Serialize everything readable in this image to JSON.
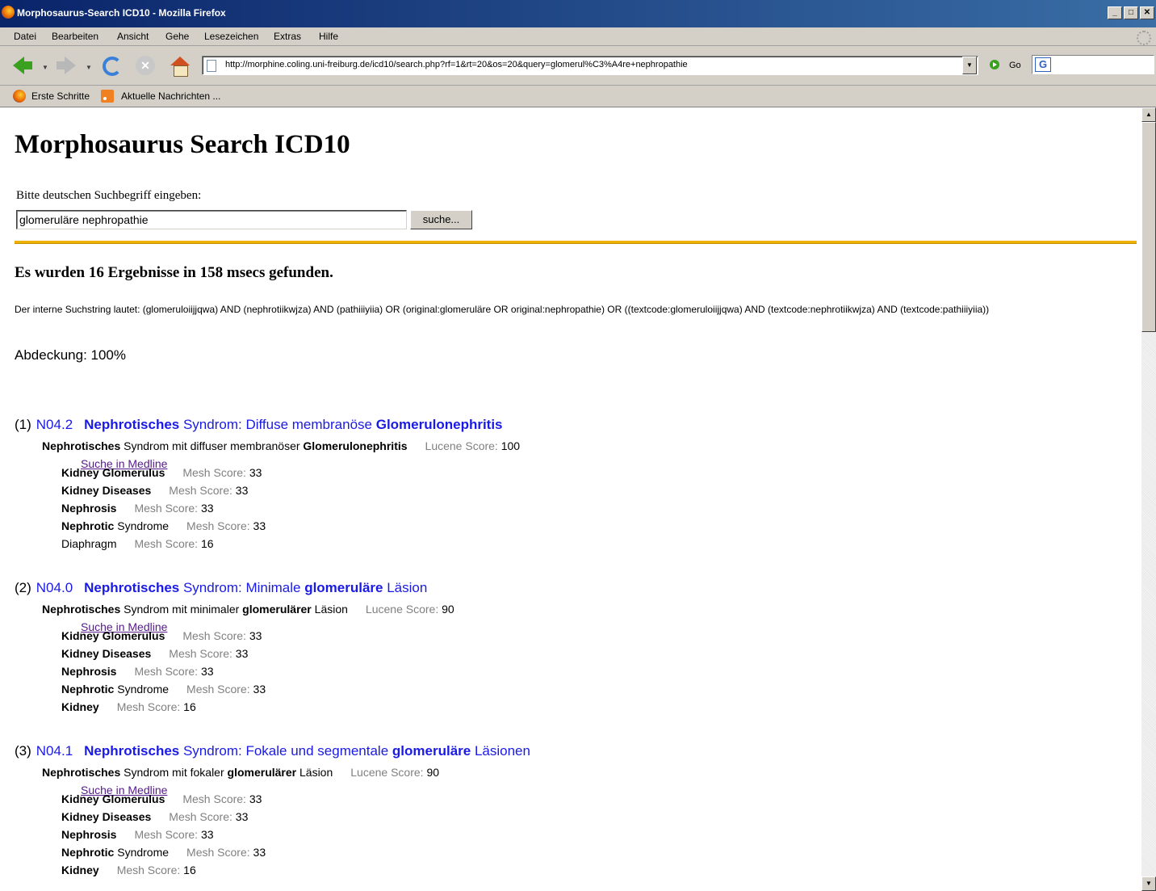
{
  "window": {
    "title": "Morphosaurus-Search ICD10 - Mozilla Firefox",
    "controls": [
      "_",
      "□",
      "✕"
    ]
  },
  "menu": [
    "Datei",
    "Bearbeiten",
    "Ansicht",
    "Gehe",
    "Lesezeichen",
    "Extras",
    "Hilfe"
  ],
  "nav": {
    "url": "http://morphine.coling.uni-freiburg.de/icd10/search.php?rf=1&rt=20&os=20&query=glomerul%C3%A4re+nephropathie",
    "go_label": "Go"
  },
  "bookmarks": [
    "Erste Schritte",
    "Aktuelle Nachrichten ..."
  ],
  "page": {
    "title": "Morphosaurus Search ICD10",
    "prompt": "Bitte deutschen Suchbegriff eingeben:",
    "search_value": "glomeruläre nephropathie",
    "search_button": "suche...",
    "results_heading": "Es wurden 16 Ergebnisse in 158 msecs gefunden.",
    "query_string": "Der interne Suchstring lautet: (glomeruloiijjqwa) AND (nephrotiikwjza) AND (pathiiiyiia) OR (original:glomeruläre OR original:nephropathie) OR ((textcode:glomeruloiijjqwa) AND (textcode:nephrotiikwjza) AND (textcode:pathiiiyiia))",
    "coverage": "Abdeckung: 100%"
  },
  "results": [
    {
      "num": "(1)",
      "code": "N04.2",
      "title_parts": [
        {
          "t": "Nephrotisches",
          "b": true
        },
        {
          "t": " Syndrom: Diffuse membranöse ",
          "b": false
        },
        {
          "t": "Glomerulonephritis",
          "b": true
        }
      ],
      "sub_parts": [
        {
          "t": "Nephrotisches",
          "b": true
        },
        {
          "t": " Syndrom mit diffuser membranöser ",
          "b": false
        },
        {
          "t": "Glomerulonephritis",
          "b": true
        }
      ],
      "lucene_label": "Lucene Score:",
      "lucene_score": "100",
      "medline": "Suche in Medline",
      "mesh": [
        {
          "parts": [
            {
              "t": "Kidney Glomerulus",
              "b": true
            }
          ],
          "label": "Mesh Score:",
          "score": "33"
        },
        {
          "parts": [
            {
              "t": "Kidney Diseases",
              "b": true
            }
          ],
          "label": "Mesh Score:",
          "score": "33"
        },
        {
          "parts": [
            {
              "t": "Nephrosis",
              "b": true
            }
          ],
          "label": "Mesh Score:",
          "score": "33"
        },
        {
          "parts": [
            {
              "t": "Nephrotic",
              "b": true
            },
            {
              "t": " Syndrome",
              "b": false
            }
          ],
          "label": "Mesh Score:",
          "score": "33"
        },
        {
          "parts": [
            {
              "t": "Diaphragm",
              "b": false
            }
          ],
          "label": "Mesh Score:",
          "score": "16"
        }
      ]
    },
    {
      "num": "(2)",
      "code": "N04.0",
      "title_parts": [
        {
          "t": "Nephrotisches",
          "b": true
        },
        {
          "t": " Syndrom: Minimale ",
          "b": false
        },
        {
          "t": "glomeruläre",
          "b": true
        },
        {
          "t": " Läsion",
          "b": false
        }
      ],
      "sub_parts": [
        {
          "t": "Nephrotisches",
          "b": true
        },
        {
          "t": " Syndrom mit minimaler ",
          "b": false
        },
        {
          "t": "glomerulärer",
          "b": true
        },
        {
          "t": " Läsion",
          "b": false
        }
      ],
      "lucene_label": "Lucene Score:",
      "lucene_score": "90",
      "medline": "Suche in Medline",
      "mesh": [
        {
          "parts": [
            {
              "t": "Kidney Glomerulus",
              "b": true
            }
          ],
          "label": "Mesh Score:",
          "score": "33"
        },
        {
          "parts": [
            {
              "t": "Kidney Diseases",
              "b": true
            }
          ],
          "label": "Mesh Score:",
          "score": "33"
        },
        {
          "parts": [
            {
              "t": "Nephrosis",
              "b": true
            }
          ],
          "label": "Mesh Score:",
          "score": "33"
        },
        {
          "parts": [
            {
              "t": "Nephrotic",
              "b": true
            },
            {
              "t": " Syndrome",
              "b": false
            }
          ],
          "label": "Mesh Score:",
          "score": "33"
        },
        {
          "parts": [
            {
              "t": "Kidney",
              "b": true
            }
          ],
          "label": "Mesh Score:",
          "score": "16"
        }
      ]
    },
    {
      "num": "(3)",
      "code": "N04.1",
      "title_parts": [
        {
          "t": "Nephrotisches",
          "b": true
        },
        {
          "t": " Syndrom: Fokale und segmentale ",
          "b": false
        },
        {
          "t": "glomeruläre",
          "b": true
        },
        {
          "t": " Läsionen",
          "b": false
        }
      ],
      "sub_parts": [
        {
          "t": "Nephrotisches",
          "b": true
        },
        {
          "t": " Syndrom mit fokaler ",
          "b": false
        },
        {
          "t": "glomerulärer",
          "b": true
        },
        {
          "t": " Läsion",
          "b": false
        }
      ],
      "lucene_label": "Lucene Score:",
      "lucene_score": "90",
      "medline": "Suche in Medline",
      "mesh": [
        {
          "parts": [
            {
              "t": "Kidney Glomerulus",
              "b": true
            }
          ],
          "label": "Mesh Score:",
          "score": "33"
        },
        {
          "parts": [
            {
              "t": "Kidney Diseases",
              "b": true
            }
          ],
          "label": "Mesh Score:",
          "score": "33"
        },
        {
          "parts": [
            {
              "t": "Nephrosis",
              "b": true
            }
          ],
          "label": "Mesh Score:",
          "score": "33"
        },
        {
          "parts": [
            {
              "t": "Nephrotic",
              "b": true
            },
            {
              "t": " Syndrome",
              "b": false
            }
          ],
          "label": "Mesh Score:",
          "score": "33"
        },
        {
          "parts": [
            {
              "t": "Kidney",
              "b": true
            }
          ],
          "label": "Mesh Score:",
          "score": "16"
        }
      ]
    }
  ]
}
